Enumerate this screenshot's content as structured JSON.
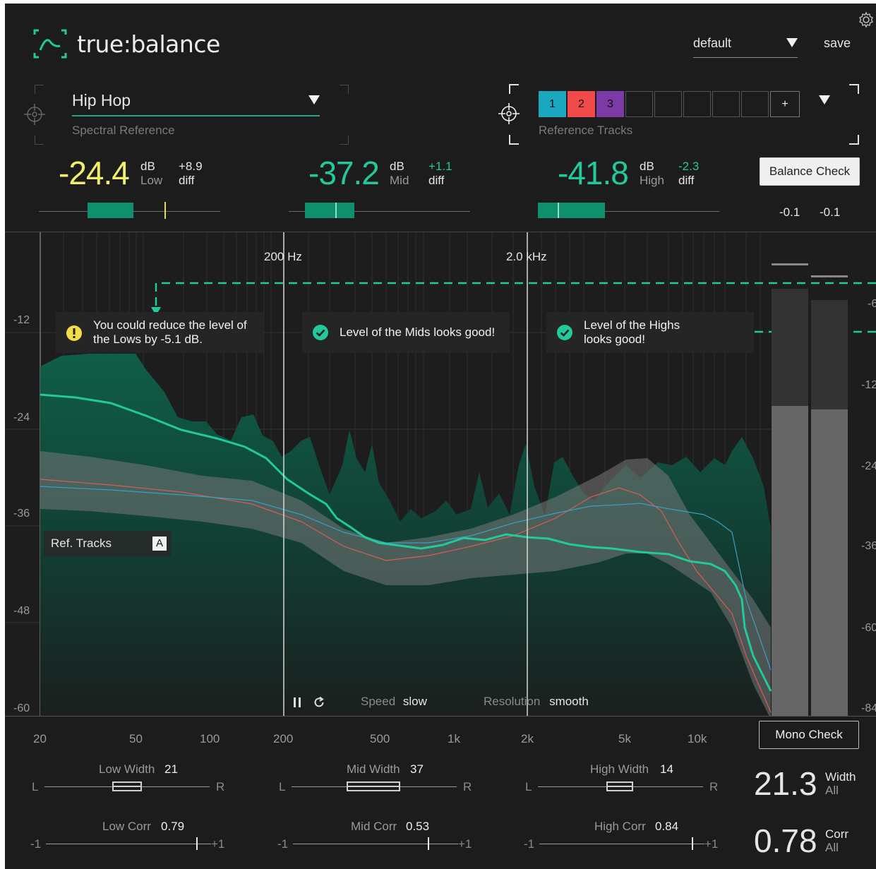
{
  "app": {
    "name": "true:balance"
  },
  "preset": {
    "name": "default",
    "save_label": "save"
  },
  "spectral_reference": {
    "name": "Hip Hop",
    "label": "Spectral Reference"
  },
  "reference_tracks": {
    "label": "Reference Tracks",
    "slots": [
      {
        "label": "1",
        "color": "#1aa8c0"
      },
      {
        "label": "2",
        "color": "#f04a4a"
      },
      {
        "label": "3",
        "color": "#7b3aa5"
      }
    ],
    "add_label": "+"
  },
  "bands": [
    {
      "value": "-24.4",
      "unit": "dB",
      "band": "Low",
      "diff": "+8.9",
      "diff_label": "diff",
      "color": "#f3ee6a",
      "diff_color": "#e6e6e6",
      "fill_from": 0.27,
      "fill_to": 0.52,
      "marker": 0.69,
      "marker_color": "#e8d84a"
    },
    {
      "value": "-37.2",
      "unit": "dB",
      "band": "Mid",
      "diff": "+1.1",
      "diff_label": "diff",
      "color": "#22c99a",
      "diff_color": "#22c99a",
      "fill_from": 0.09,
      "fill_to": 0.36,
      "marker": 0.26,
      "marker_color": "#8fe0c8"
    },
    {
      "value": "-41.8",
      "unit": "dB",
      "band": "High",
      "diff": "-2.3",
      "diff_label": "diff",
      "color": "#22c99a",
      "diff_color": "#22c99a",
      "fill_from": 0.0,
      "fill_to": 0.37,
      "marker": 0.11,
      "marker_color": "#8fe0c8"
    }
  ],
  "balance_check": {
    "label": "Balance Check",
    "left": "-0.1",
    "right": "-0.1"
  },
  "graph": {
    "marker_low": "200 Hz",
    "marker_high": "2.0 kHz",
    "y_left": [
      "-12",
      "-24",
      "-36",
      "-48",
      "-60"
    ],
    "y_right": [
      "-6",
      "-12",
      "-24",
      "-36",
      "-60",
      "-84"
    ],
    "x_labels": [
      "20",
      "50",
      "100",
      "200",
      "500",
      "1k",
      "2k",
      "5k",
      "10k"
    ],
    "messages": {
      "low": "You could reduce the level of the Lows by -5.1 dB.",
      "mid": "Level of the Mids looks good!",
      "high": "Level of the Highs looks good!"
    },
    "ref_tracks_label": "Ref. Tracks",
    "ref_tracks_badge": "A",
    "speed_label": "Speed",
    "speed_value": "slow",
    "resolution_label": "Resolution",
    "resolution_value": "smooth",
    "pause_icon": "pause-icon",
    "reset_icon": "reset-icon"
  },
  "mono_check": {
    "label": "Mono Check"
  },
  "stereo": [
    {
      "width_label": "Low Width",
      "width_value": "21",
      "corr_label": "Low Corr",
      "corr_value": "0.79"
    },
    {
      "width_label": "Mid Width",
      "width_value": "37",
      "corr_label": "Mid Corr",
      "corr_value": "0.53"
    },
    {
      "width_label": "High Width",
      "width_value": "14",
      "corr_label": "High Corr",
      "corr_value": "0.84"
    }
  ],
  "stereo_labels": {
    "left": "L",
    "right": "R",
    "minus": "-1",
    "plus": "+1"
  },
  "summary": {
    "width_value": "21.3",
    "width_label": "Width",
    "width_scope": "All",
    "corr_value": "0.78",
    "corr_label": "Corr",
    "corr_scope": "All"
  }
}
